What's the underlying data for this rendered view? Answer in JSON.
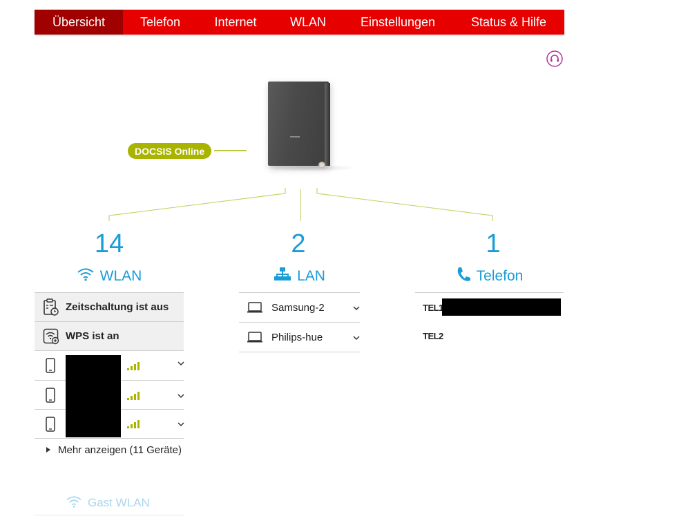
{
  "nav": {
    "tabs": [
      {
        "label": "Übersicht",
        "active": true
      },
      {
        "label": "Telefon",
        "active": false
      },
      {
        "label": "Internet",
        "active": false
      },
      {
        "label": "WLAN",
        "active": false
      },
      {
        "label": "Einstellungen",
        "active": false
      },
      {
        "label": "Status & Hilfe",
        "active": false
      }
    ]
  },
  "icons": {
    "support": "headset-icon",
    "wlan": "wifi-icon",
    "lan": "network-icon",
    "telefon": "phone-icon",
    "schedule": "schedule-icon",
    "wps": "wps-icon",
    "device": "smartphone-icon",
    "laptop": "laptop-icon",
    "signal": "signal-icon",
    "chevron": "chevron-down-icon",
    "triangle": "triangle-right-icon"
  },
  "colors": {
    "brand_red": "#e60000",
    "active_tab": "#a00000",
    "accent_blue": "#1a9cd6",
    "status_green": "#a8b400"
  },
  "router": {
    "status": "DOCSIS Online"
  },
  "wlan": {
    "count": "14",
    "title": "WLAN",
    "timer_label": "Zeitschaltung ist aus",
    "wps_label": "WPS ist an",
    "devices": [
      {
        "name": ""
      },
      {
        "name": ""
      },
      {
        "name": ""
      }
    ],
    "more": "Mehr anzeigen (11 Geräte)",
    "guest": "Gast WLAN"
  },
  "lan": {
    "count": "2",
    "title": "LAN",
    "devices": [
      "Samsung-2",
      "Philips-hue"
    ]
  },
  "telefon": {
    "count": "1",
    "title": "Telefon",
    "lines": [
      "TEL1",
      "TEL2"
    ]
  }
}
